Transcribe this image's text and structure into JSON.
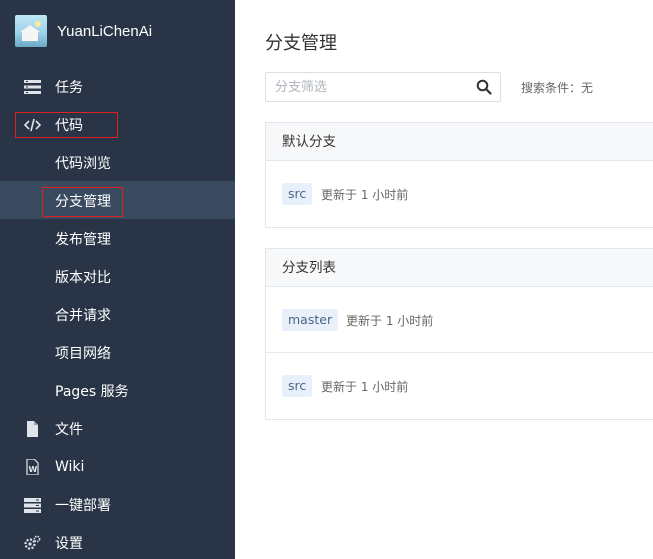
{
  "project": {
    "name": "YuanLiChenAi"
  },
  "sidebar": {
    "items": [
      {
        "label": "任务",
        "icon": "task-list-icon"
      },
      {
        "label": "代码",
        "icon": "code-icon"
      },
      {
        "label": "文件",
        "icon": "file-icon"
      },
      {
        "label": "Wiki",
        "icon": "wiki-icon"
      },
      {
        "label": "一键部署",
        "icon": "deploy-icon"
      },
      {
        "label": "设置",
        "icon": "gear-icon"
      }
    ],
    "code_sub": [
      {
        "label": "代码浏览"
      },
      {
        "label": "分支管理"
      },
      {
        "label": "发布管理"
      },
      {
        "label": "版本对比"
      },
      {
        "label": "合并请求"
      },
      {
        "label": "项目网络"
      },
      {
        "label": "Pages 服务"
      }
    ]
  },
  "main": {
    "title": "分支管理",
    "search": {
      "placeholder": "分支筛选",
      "value": "",
      "condition": "搜索条件：无"
    },
    "default_branch": {
      "header": "默认分支",
      "rows": [
        {
          "name": "src",
          "updated": "更新于 1 小时前"
        }
      ]
    },
    "branch_list": {
      "header": "分支列表",
      "rows": [
        {
          "name": "master",
          "updated": "更新于 1 小时前"
        },
        {
          "name": "src",
          "updated": "更新于 1 小时前"
        }
      ]
    }
  },
  "colors": {
    "sidebar_bg": "#293547",
    "active_bg": "#3a4a5f",
    "highlight_box": "#e02020",
    "tag_bg": "#e8f1fb"
  }
}
